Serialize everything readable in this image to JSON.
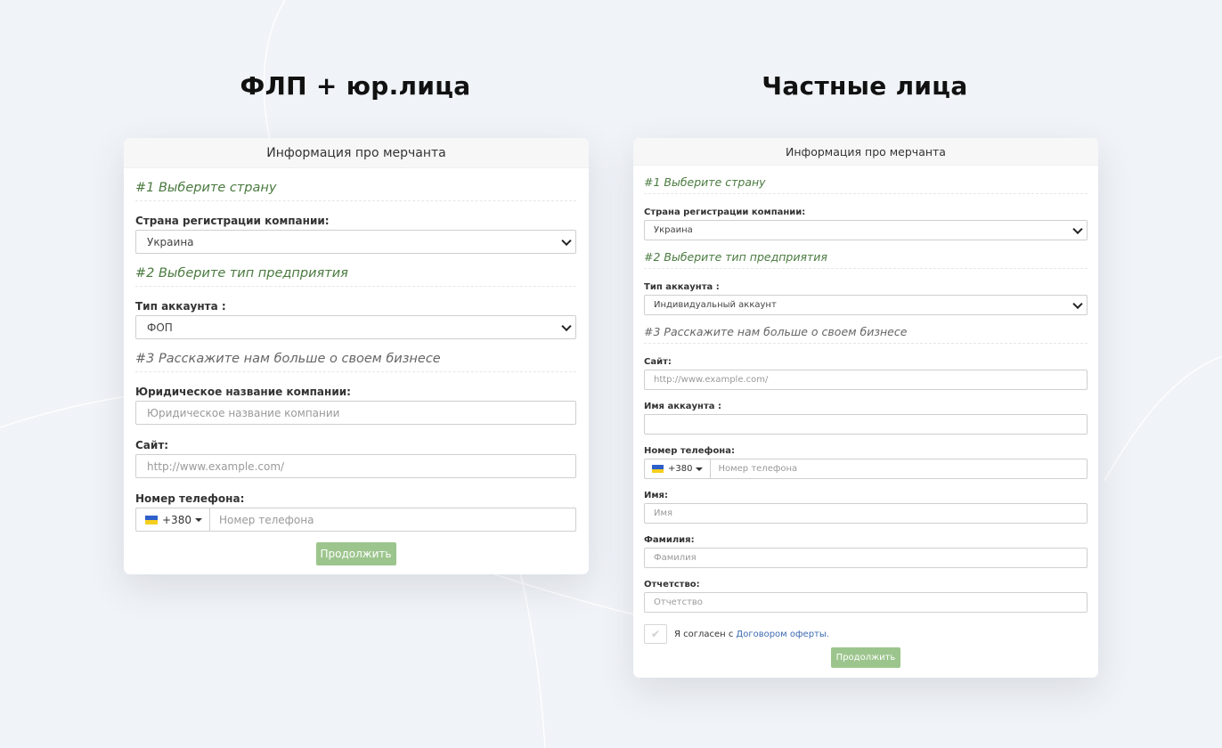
{
  "left": {
    "heading": "ФЛП + юр.лица",
    "card": {
      "title": "Информация про мерчанта",
      "step1": "#1 Выберите страну",
      "country_label": "Страна регистрации компании:",
      "country_value": "Украина",
      "step2": "#2 Выберите тип предприятия",
      "account_type_label": "Тип аккаунта :",
      "account_type_value": "ФОП",
      "step3": "#3 Расскажите нам больше о своем бизнесе",
      "legal_name_label": "Юридическое название компании:",
      "legal_name_placeholder": "Юридическое название компании",
      "site_label": "Сайт:",
      "site_placeholder": "http://www.example.com/",
      "phone_label": "Номер телефона:",
      "phone_code": "+380",
      "phone_placeholder": "Номер телефона",
      "continue_button": "Продолжить"
    }
  },
  "right": {
    "heading": "Частные лица",
    "card": {
      "title": "Информация про мерчанта",
      "step1": "#1 Выберите страну",
      "country_label": "Страна регистрации компании:",
      "country_value": "Украина",
      "step2": "#2 Выберите тип предприятия",
      "account_type_label": "Тип аккаунта :",
      "account_type_value": "Индивидуальный аккаунт",
      "step3": "#3 Расскажите нам больше о своем бизнесе",
      "site_label": "Сайт:",
      "site_placeholder": "http://www.example.com/",
      "account_name_label": "Имя аккаунта :",
      "account_name_value": "",
      "phone_label": "Номер телефона:",
      "phone_code": "+380",
      "phone_placeholder": "Номер телефона",
      "first_name_label": "Имя:",
      "first_name_placeholder": "Имя",
      "last_name_label": "Фамилия:",
      "last_name_placeholder": "Фамилия",
      "patronymic_label": "Отчетство:",
      "patronymic_placeholder": "Отчетство",
      "agree_text": "Я согласен с",
      "agree_link": "Договором оферты.",
      "continue_button": "Продолжить"
    }
  },
  "colors": {
    "background": "#f0f3f7",
    "step_green": "#4a7a3f",
    "button_green": "#9cc58d",
    "link_blue": "#3d6bb0",
    "flag_blue": "#2f5fcb",
    "flag_yellow": "#f5cf1e"
  },
  "icons": {
    "flag": "ukraine-flag-icon",
    "select_arrow": "chevron-down-icon",
    "dropdown_caret": "caret-down-icon",
    "checkbox_mark": "checkmark-icon"
  }
}
